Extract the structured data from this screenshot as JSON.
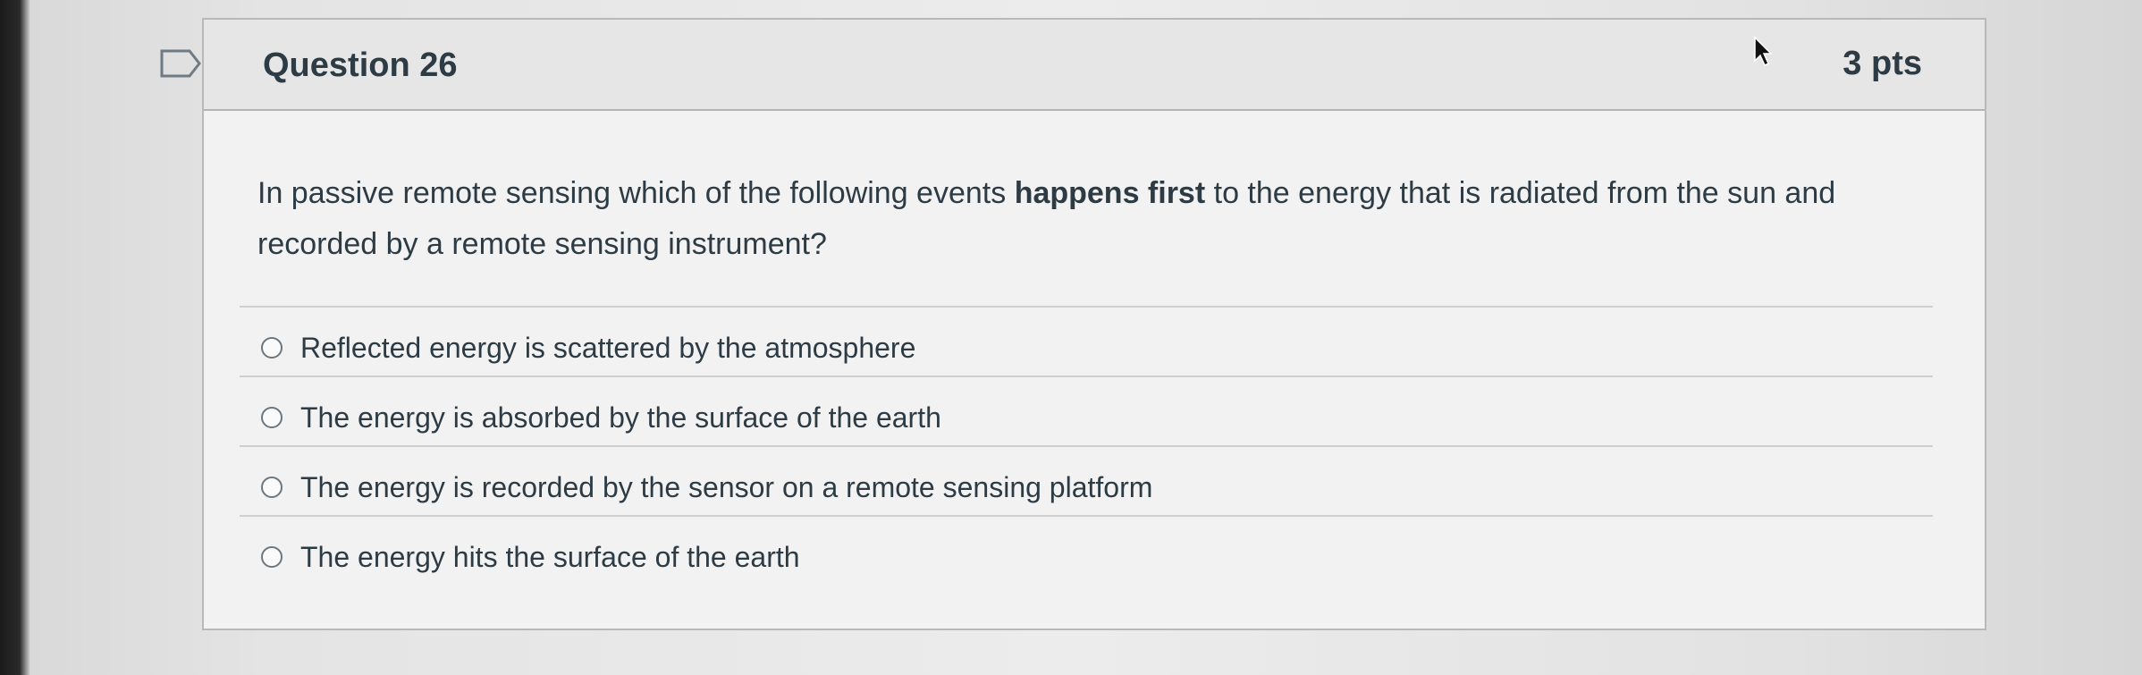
{
  "question": {
    "title": "Question 26",
    "points": "3 pts",
    "text_before": "In passive remote sensing which of the following events ",
    "text_bold": "happens first",
    "text_after": " to the energy that is radiated from the sun and recorded by a remote sensing instrument?"
  },
  "answers": [
    {
      "label": "Reflected energy is scattered by the atmosphere",
      "selected": false
    },
    {
      "label": "The energy is absorbed by the surface of the earth",
      "selected": false
    },
    {
      "label": "The energy is recorded by the sensor on a remote sensing platform",
      "selected": false
    },
    {
      "label": "The energy hits the surface of the earth",
      "selected": false
    }
  ],
  "icons": {
    "bookmark": "bookmark-flag-icon",
    "cursor": "mouse-cursor-icon"
  },
  "colors": {
    "text": "#2d3b45",
    "header_bg": "#e6e6e6",
    "card_bg": "#f2f2f2"
  }
}
